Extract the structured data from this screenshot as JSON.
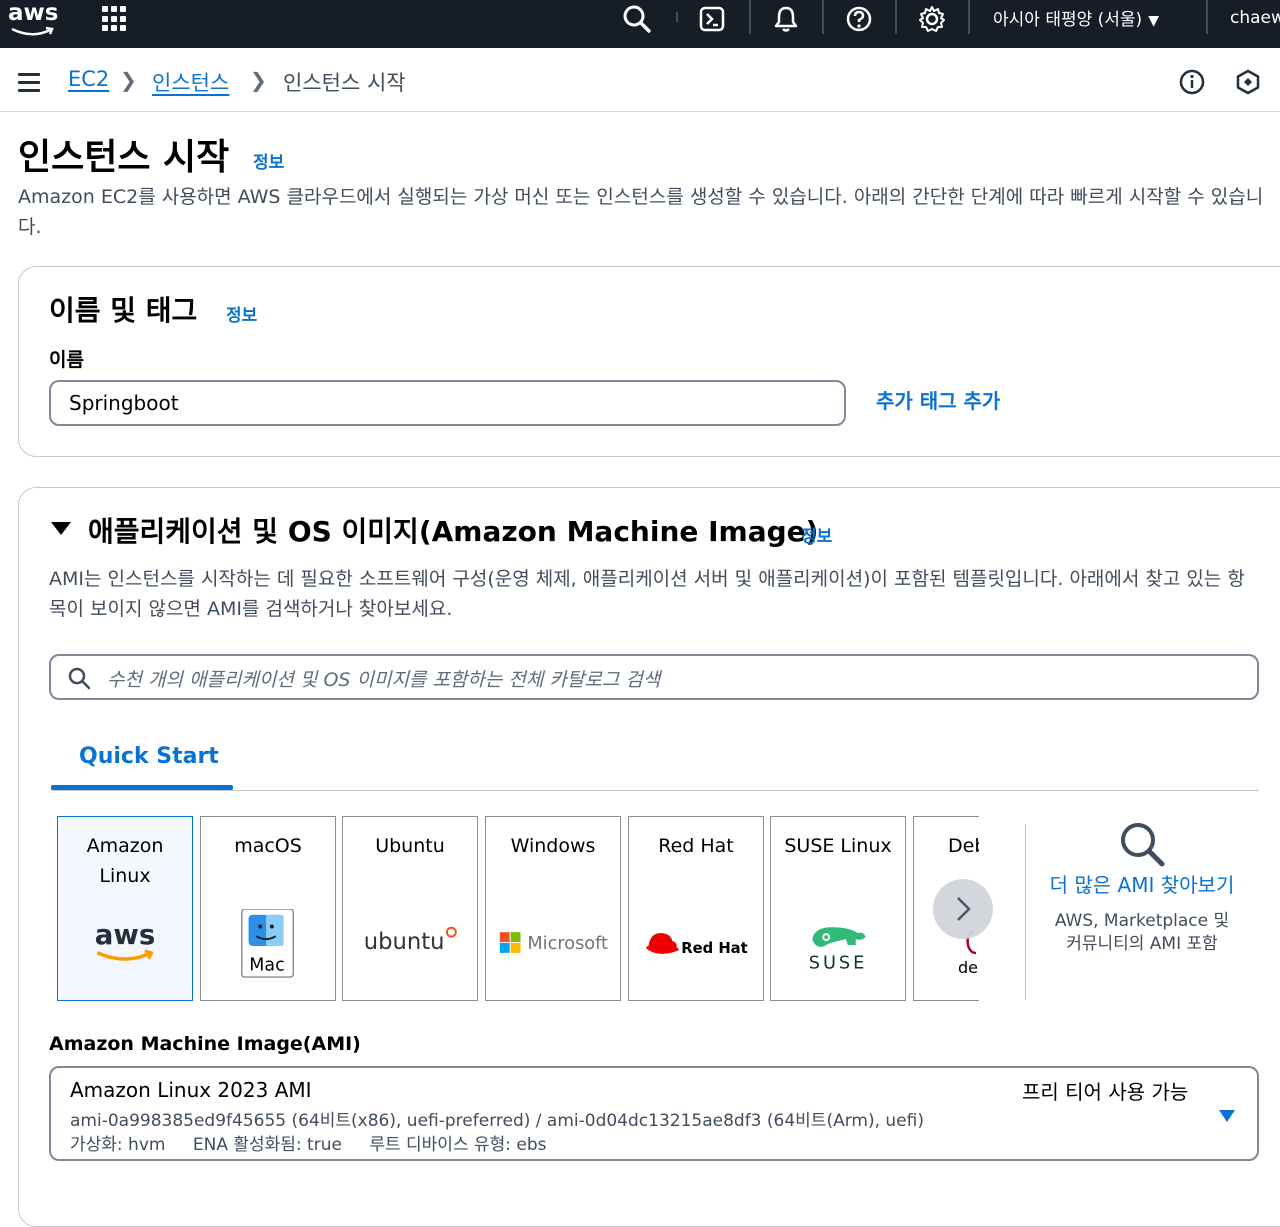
{
  "topbar": {
    "logo_text": "aws",
    "region": "아시아 태평양 (서울)",
    "user": "chaew",
    "icons": [
      "apps-grid-icon",
      "search-icon",
      "cloudshell-icon",
      "bell-icon",
      "help-icon",
      "settings-icon"
    ]
  },
  "breadcrumb": {
    "items": [
      "EC2",
      "인스턴스",
      "인스턴스 시작"
    ]
  },
  "page": {
    "title": "인스턴스 시작",
    "info": "정보",
    "description": "Amazon EC2를 사용하면 AWS 클라우드에서 실행되는 가상 머신 또는 인스턴스를 생성할 수 있습니다. 아래의 간단한 단계에 따라 빠르게 시작할 수 있습니다."
  },
  "name_tags": {
    "title": "이름 및 태그",
    "info": "정보",
    "label": "이름",
    "value": "Springboot",
    "add_tag": "추가 태그 추가"
  },
  "ami_section": {
    "title": "애플리케이션 및 OS 이미지(Amazon Machine Image)",
    "info": "정보",
    "description": "AMI는 인스턴스를 시작하는 데 필요한 소프트웨어 구성(운영 체제, 애플리케이션 서버 및 애플리케이션)이 포함된 템플릿입니다. 아래에서 찾고 있는 항목이 보이지 않으면 AMI를 검색하거나 찾아보세요.",
    "search_placeholder": "수천 개의 애플리케이션 및 OS 이미지를 포함하는 전체 카탈로그 검색",
    "tab": "Quick Start",
    "tiles": [
      {
        "name": "Amazon Linux",
        "logo": "aws",
        "selected": true
      },
      {
        "name": "macOS",
        "logo": "Mac"
      },
      {
        "name": "Ubuntu",
        "logo": "ubuntu"
      },
      {
        "name": "Windows",
        "logo": "Microsoft"
      },
      {
        "name": "Red Hat",
        "logo": "Red Hat"
      },
      {
        "name": "SUSE Linux",
        "logo": "SUSE"
      },
      {
        "name": "Deb",
        "logo": "deb"
      }
    ],
    "more": {
      "link": "더 많은 AMI 찾아보기",
      "sub": "AWS, Marketplace 및 커뮤니티의 AMI 포함"
    },
    "ami_label": "Amazon Machine Image(AMI)",
    "selected_ami": {
      "name": "Amazon Linux 2023 AMI",
      "ids": "ami-0a998385ed9f45655 (64비트(x86), uefi-preferred) / ami-0d04dc13215ae8df3 (64비트(Arm), uefi)",
      "virtualization": "가상화: hvm",
      "ena": "ENA 활성화됨: true",
      "root_device": "루트 디바이스 유형: ebs",
      "badge": "프리 티어 사용 가능"
    }
  },
  "colors": {
    "topbar_bg": "#161d26",
    "link": "#0972d3",
    "selected_tile_bg": "#f2f8fd"
  }
}
